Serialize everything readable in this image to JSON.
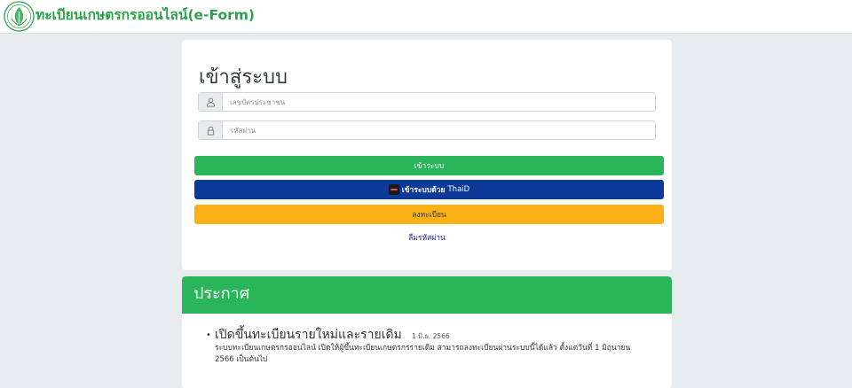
{
  "header": {
    "brand": "ทะเบียนเกษตรกรออนไลน์(e-Form)"
  },
  "login": {
    "title": "เข้าสู่ระบบ",
    "username_placeholder": "เลขบัตรประชาชน",
    "password_placeholder": "รหัสผ่าน",
    "login_button": "เข้าระบบ",
    "thaid_button_bold": "เข้าระบบด้วย",
    "thaid_button_brand": "ThaiD",
    "register_button": "ลงทะเบียน",
    "forgot_password": "ลืมรหัสผ่าน"
  },
  "announcement": {
    "title": "ประกาศ",
    "items": [
      {
        "title": "เปิดขึ้นทะเบียนรายใหม่และรายเดิม",
        "date": "1 มิ.ย. 2566",
        "body": "ระบบทะเบียนเกษตรกรออนไลน์ เปิดให้ผู้ขึ้นทะเบียนเกษตรกรรายเดิม สามารถลงทะเบียนผ่านระบบนี้ได้แล้ว ตั้งแต่วันที่ 1 มิถุนายน 2566 เป็นต้นไป"
      }
    ]
  },
  "colors": {
    "brand_green": "#2aa348",
    "button_green": "#2bb55a",
    "thaid_blue": "#0b3a9b",
    "register_yellow": "#fbb116",
    "page_background": "#e9ecef"
  },
  "icons": {
    "logo": "doa-emblem-icon",
    "username": "user-icon",
    "password": "lock-icon",
    "thaid": "thaid-logo-icon"
  }
}
